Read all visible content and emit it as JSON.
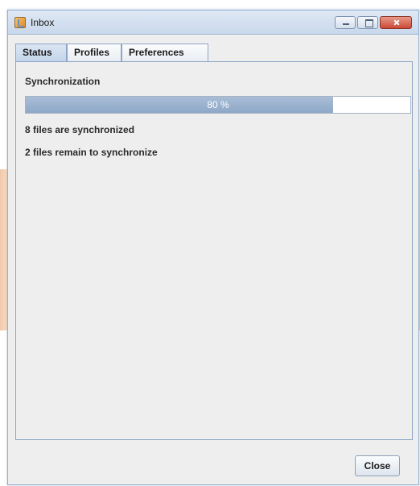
{
  "window": {
    "title": "Inbox"
  },
  "tabs": [
    {
      "label": "Status",
      "active": true
    },
    {
      "label": "Profiles",
      "active": false
    },
    {
      "label": "Preferences",
      "active": false
    }
  ],
  "status": {
    "section_label": "Synchronization",
    "progress_percent": 80,
    "progress_label": "80 %",
    "synced_text": "8 files are synchronized",
    "remaining_text": "2 files remain to synchronize"
  },
  "footer": {
    "close_label": "Close"
  },
  "colors": {
    "progress_fill": "#8ea8c8",
    "close_button_red": "#c94a35",
    "window_border": "#8fb0d4"
  },
  "icons": [
    "app-icon",
    "minimize-icon",
    "maximize-icon",
    "close-icon"
  ]
}
